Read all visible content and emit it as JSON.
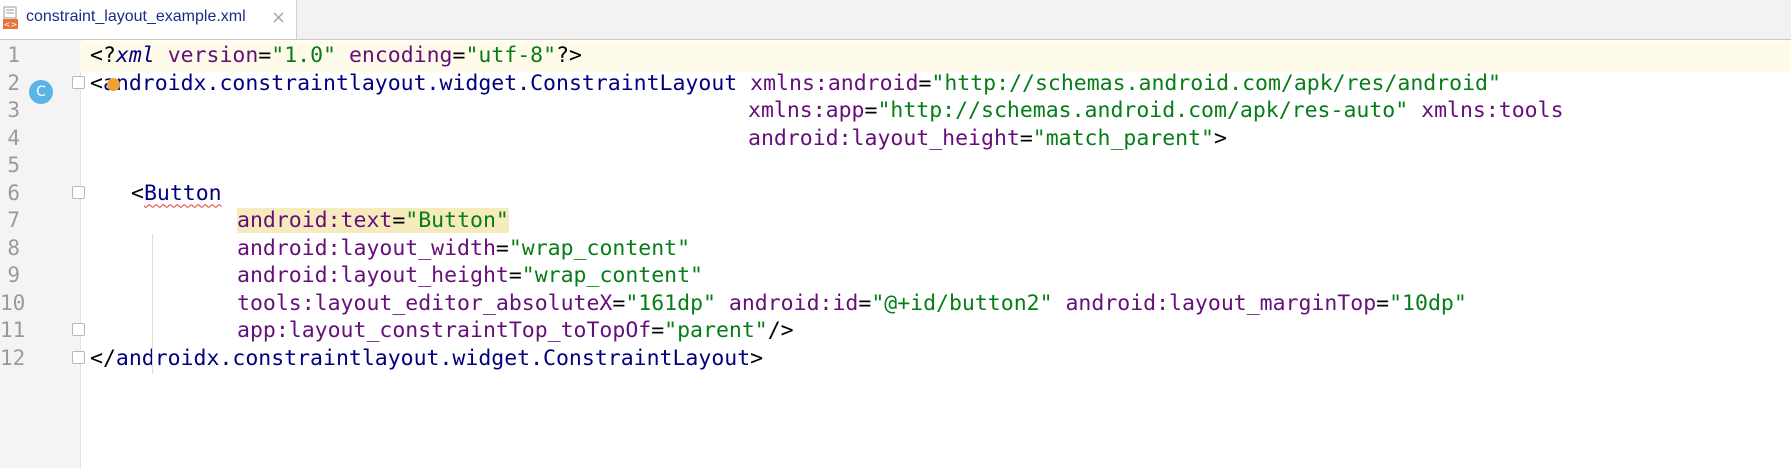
{
  "tab": {
    "file_name": "constraint_layout_example.xml",
    "close_symbol": "×",
    "icon": "xml-file-icon"
  },
  "gutter": {
    "line_numbers": [
      "1",
      "2",
      "3",
      "4",
      "5",
      "6",
      "7",
      "8",
      "9",
      "10",
      "11",
      "12"
    ],
    "badge_label": "C"
  },
  "code": {
    "l1": {
      "lt": "<?",
      "name": "xml",
      "sp1": " ",
      "a1": "version",
      "eq1": "=",
      "v1": "\"1.0\"",
      "sp2": " ",
      "a2": "encoding",
      "eq2": "=",
      "v2": "\"utf-8\"",
      "end": "?>"
    },
    "l2": {
      "lt": "<",
      "tag": "androidx.constraintlayout.widget.ConstraintLayout",
      "sp": " ",
      "attr": "xmlns:android",
      "eq": "=",
      "val": "\"http://schemas.android.com/apk/res/android\""
    },
    "l3": {
      "attr1": "xmlns:app",
      "eq1": "=",
      "val1": "\"http://schemas.android.com/apk/res-auto\"",
      "sp": " ",
      "attr2": "xmlns:tools"
    },
    "l4": {
      "attr": "android:layout_height",
      "eq": "=",
      "val": "\"match_parent\"",
      "end": ">"
    },
    "l6": {
      "lt": "<",
      "tag": "Button"
    },
    "l7": {
      "attr": "android:text",
      "eq": "=",
      "val": "\"Button\""
    },
    "l8": {
      "attr": "android:layout_width",
      "eq": "=",
      "val": "\"wrap_content\""
    },
    "l9": {
      "attr": "android:layout_height",
      "eq": "=",
      "val": "\"wrap_content\""
    },
    "l10": {
      "attr1": "tools:layout_editor_absoluteX",
      "eq1": "=",
      "val1": "\"161dp\"",
      "sp1": " ",
      "attr2": "android:id",
      "eq2": "=",
      "val2": "\"@+id/button2\"",
      "sp2": " ",
      "attr3": "android:layout_marginTop",
      "eq3": "=",
      "val3": "\"10dp\""
    },
    "l11": {
      "attr": "app:layout_constraintTop_toTopOf",
      "eq": "=",
      "val": "\"parent\"",
      "end": "/>"
    },
    "l12": {
      "lt": "</",
      "tag": "androidx.constraintlayout.widget.ConstraintLayout",
      "end": ">"
    }
  },
  "colors": {
    "tag": "#000080",
    "attribute": "#660e7a",
    "value": "#067d17",
    "caret_line": "#fefbea",
    "highlight": "#f6ebbc",
    "error_underline": "#e53935"
  }
}
